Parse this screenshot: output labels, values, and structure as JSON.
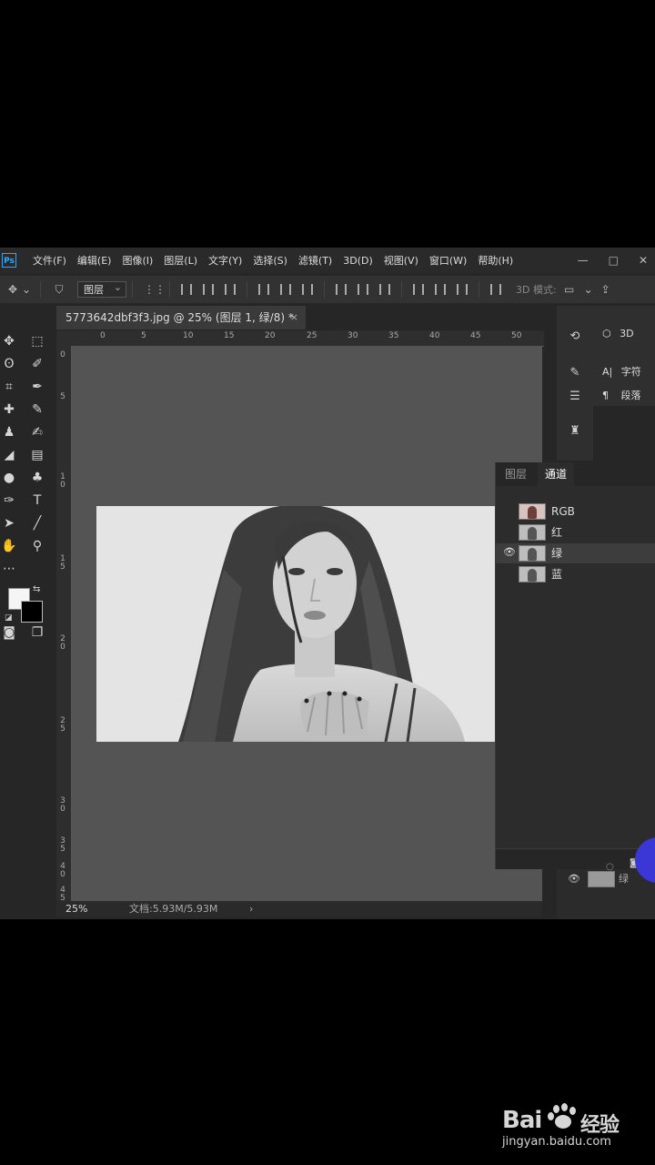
{
  "app": {
    "logo": "Ps",
    "menu": [
      "文件(F)",
      "编辑(E)",
      "图像(I)",
      "图层(L)",
      "文字(Y)",
      "选择(S)",
      "滤镜(T)",
      "3D(D)",
      "视图(V)",
      "窗口(W)",
      "帮助(H)"
    ],
    "window_controls": [
      "—",
      "□",
      "✕"
    ]
  },
  "options_bar": {
    "auto_select_value": "图层",
    "mode_3d_label": "3D 模式:"
  },
  "document": {
    "tab_title": "5773642dbf3f3.jpg @ 25% (图层 1, 绿/8) *",
    "close": "×"
  },
  "ruler": {
    "top_labels": [
      "0",
      "5",
      "10",
      "15",
      "20",
      "25",
      "30",
      "35",
      "40",
      "45",
      "50"
    ],
    "left_labels": [
      "0",
      "5",
      "1 0",
      "1 5",
      "2 0",
      "2 5",
      "3 0",
      "3 5",
      "4 0",
      "4 5"
    ]
  },
  "status": {
    "zoom": "25%",
    "doc_size": "文档:5.93M/5.93M",
    "arrow": "›"
  },
  "right_panel": {
    "items": [
      {
        "icon": "cube-icon",
        "label": "3D"
      },
      {
        "icon": "character-icon",
        "label": "字符"
      },
      {
        "icon": "paragraph-icon",
        "label": "段落"
      }
    ]
  },
  "channels_panel": {
    "tabs": [
      {
        "label": "图层",
        "active": false
      },
      {
        "label": "通道",
        "active": true
      }
    ],
    "channels": [
      {
        "name": "RGB",
        "visible": false,
        "selected": false
      },
      {
        "name": "红",
        "visible": false,
        "selected": false
      },
      {
        "name": "绿",
        "visible": true,
        "selected": true
      },
      {
        "name": "蓝",
        "visible": false,
        "selected": false
      }
    ]
  },
  "layers_strip": {
    "label": "绿"
  },
  "watermark": {
    "brand": "Bai",
    "brand_suffix": "经验",
    "url": "jingyan.baidu.com"
  }
}
